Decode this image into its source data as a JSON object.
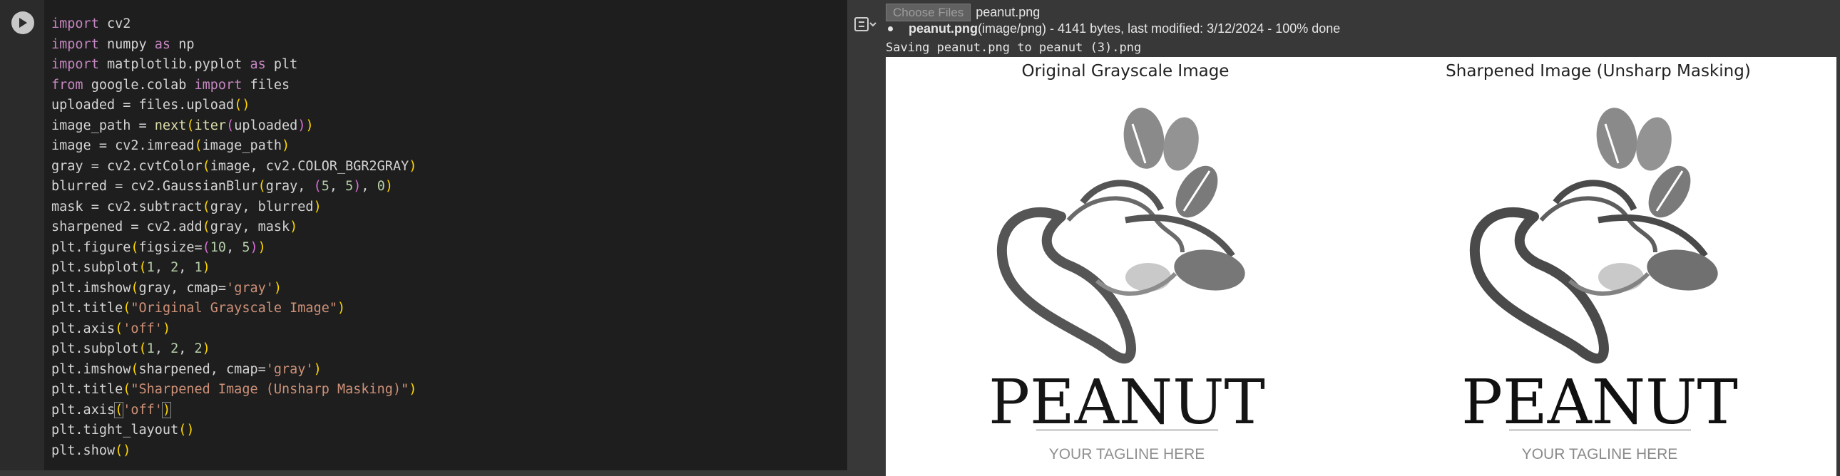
{
  "code_cell": {
    "lines": [
      [
        {
          "t": "import",
          "c": "kw"
        },
        {
          "t": " cv2"
        }
      ],
      [
        {
          "t": "import",
          "c": "kw"
        },
        {
          "t": " numpy "
        },
        {
          "t": "as",
          "c": "kw"
        },
        {
          "t": " np"
        }
      ],
      [
        {
          "t": "import",
          "c": "kw"
        },
        {
          "t": " matplotlib.pyplot "
        },
        {
          "t": "as",
          "c": "kw"
        },
        {
          "t": " plt"
        }
      ],
      [
        {
          "t": "from",
          "c": "kw"
        },
        {
          "t": " google.colab "
        },
        {
          "t": "import",
          "c": "kw"
        },
        {
          "t": " files"
        }
      ],
      [
        {
          "t": "uploaded = files.upload"
        },
        {
          "t": "()",
          "c": "p1"
        }
      ],
      [
        {
          "t": "image_path = "
        },
        {
          "t": "next",
          "c": "fn"
        },
        {
          "t": "(",
          "c": "p1"
        },
        {
          "t": "iter",
          "c": "fn"
        },
        {
          "t": "(",
          "c": "p2"
        },
        {
          "t": "uploaded"
        },
        {
          "t": ")",
          "c": "p2"
        },
        {
          "t": ")",
          "c": "p1"
        }
      ],
      [
        {
          "t": "image = cv2.imread"
        },
        {
          "t": "(",
          "c": "p1"
        },
        {
          "t": "image_path"
        },
        {
          "t": ")",
          "c": "p1"
        }
      ],
      [
        {
          "t": "gray = cv2.cvtColor"
        },
        {
          "t": "(",
          "c": "p1"
        },
        {
          "t": "image, cv2.COLOR_BGR2GRAY"
        },
        {
          "t": ")",
          "c": "p1"
        }
      ],
      [
        {
          "t": "blurred = cv2.GaussianBlur"
        },
        {
          "t": "(",
          "c": "p1"
        },
        {
          "t": "gray, "
        },
        {
          "t": "(",
          "c": "p2"
        },
        {
          "t": "5",
          "c": "num"
        },
        {
          "t": ", "
        },
        {
          "t": "5",
          "c": "num"
        },
        {
          "t": ")",
          "c": "p2"
        },
        {
          "t": ", "
        },
        {
          "t": "0",
          "c": "num"
        },
        {
          "t": ")",
          "c": "p1"
        }
      ],
      [
        {
          "t": "mask = cv2.subtract"
        },
        {
          "t": "(",
          "c": "p1"
        },
        {
          "t": "gray, blurred"
        },
        {
          "t": ")",
          "c": "p1"
        }
      ],
      [
        {
          "t": "sharpened = cv2.add"
        },
        {
          "t": "(",
          "c": "p1"
        },
        {
          "t": "gray, mask"
        },
        {
          "t": ")",
          "c": "p1"
        }
      ],
      [
        {
          "t": "plt.figure"
        },
        {
          "t": "(",
          "c": "p1"
        },
        {
          "t": "figsize="
        },
        {
          "t": "(",
          "c": "p2"
        },
        {
          "t": "10",
          "c": "num"
        },
        {
          "t": ", "
        },
        {
          "t": "5",
          "c": "num"
        },
        {
          "t": ")",
          "c": "p2"
        },
        {
          "t": ")",
          "c": "p1"
        }
      ],
      [
        {
          "t": "plt.subplot"
        },
        {
          "t": "(",
          "c": "p1"
        },
        {
          "t": "1",
          "c": "num"
        },
        {
          "t": ", "
        },
        {
          "t": "2",
          "c": "num"
        },
        {
          "t": ", "
        },
        {
          "t": "1",
          "c": "num"
        },
        {
          "t": ")",
          "c": "p1"
        }
      ],
      [
        {
          "t": "plt.imshow"
        },
        {
          "t": "(",
          "c": "p1"
        },
        {
          "t": "gray, cmap="
        },
        {
          "t": "'gray'",
          "c": "str"
        },
        {
          "t": ")",
          "c": "p1"
        }
      ],
      [
        {
          "t": "plt.title"
        },
        {
          "t": "(",
          "c": "p1"
        },
        {
          "t": "\"Original Grayscale Image\"",
          "c": "str"
        },
        {
          "t": ")",
          "c": "p1"
        }
      ],
      [
        {
          "t": "plt.axis"
        },
        {
          "t": "(",
          "c": "p1"
        },
        {
          "t": "'off'",
          "c": "str"
        },
        {
          "t": ")",
          "c": "p1"
        }
      ],
      [
        {
          "t": "plt.subplot"
        },
        {
          "t": "(",
          "c": "p1"
        },
        {
          "t": "1",
          "c": "num"
        },
        {
          "t": ", "
        },
        {
          "t": "2",
          "c": "num"
        },
        {
          "t": ", "
        },
        {
          "t": "2",
          "c": "num"
        },
        {
          "t": ")",
          "c": "p1"
        }
      ],
      [
        {
          "t": "plt.imshow"
        },
        {
          "t": "(",
          "c": "p1"
        },
        {
          "t": "sharpened, cmap="
        },
        {
          "t": "'gray'",
          "c": "str"
        },
        {
          "t": ")",
          "c": "p1"
        }
      ],
      [
        {
          "t": "plt.title"
        },
        {
          "t": "(",
          "c": "p1"
        },
        {
          "t": "\"Sharpened Image (Unsharp Masking)\"",
          "c": "str"
        },
        {
          "t": ")",
          "c": "p1"
        }
      ],
      [
        {
          "t": "plt.axis"
        },
        {
          "t": "(",
          "c": "p1 cursor-box"
        },
        {
          "t": "'off'",
          "c": "str"
        },
        {
          "t": ")",
          "c": "p1 cursor-box"
        }
      ],
      [
        {
          "t": "plt.tight_layout"
        },
        {
          "t": "()",
          "c": "p1"
        }
      ],
      [
        {
          "t": "plt.show"
        },
        {
          "t": "()",
          "c": "p1"
        }
      ]
    ]
  },
  "output": {
    "choose_files_label": "Choose Files",
    "selected_file": "peanut.png",
    "file_info_name": "peanut.png",
    "file_info_detail": "(image/png) - 4141 bytes, last modified: 3/12/2024 - 100% done",
    "saving_text": "Saving peanut.png to peanut (3).png"
  },
  "figure": {
    "left_title": "Original Grayscale Image",
    "right_title": "Sharpened Image (Unsharp Masking)",
    "logo_word": "PEANUT",
    "logo_tagline": "YOUR TAGLINE HERE"
  },
  "icons": {
    "run": "play-icon",
    "output_toggle": "output-toggle-icon"
  },
  "colors": {
    "cell_bg": "#1e1e1e",
    "output_bg": "#383838",
    "keyword": "#c586c0",
    "string": "#ce9178",
    "number": "#b5cea8",
    "function": "#dcdcaa"
  }
}
